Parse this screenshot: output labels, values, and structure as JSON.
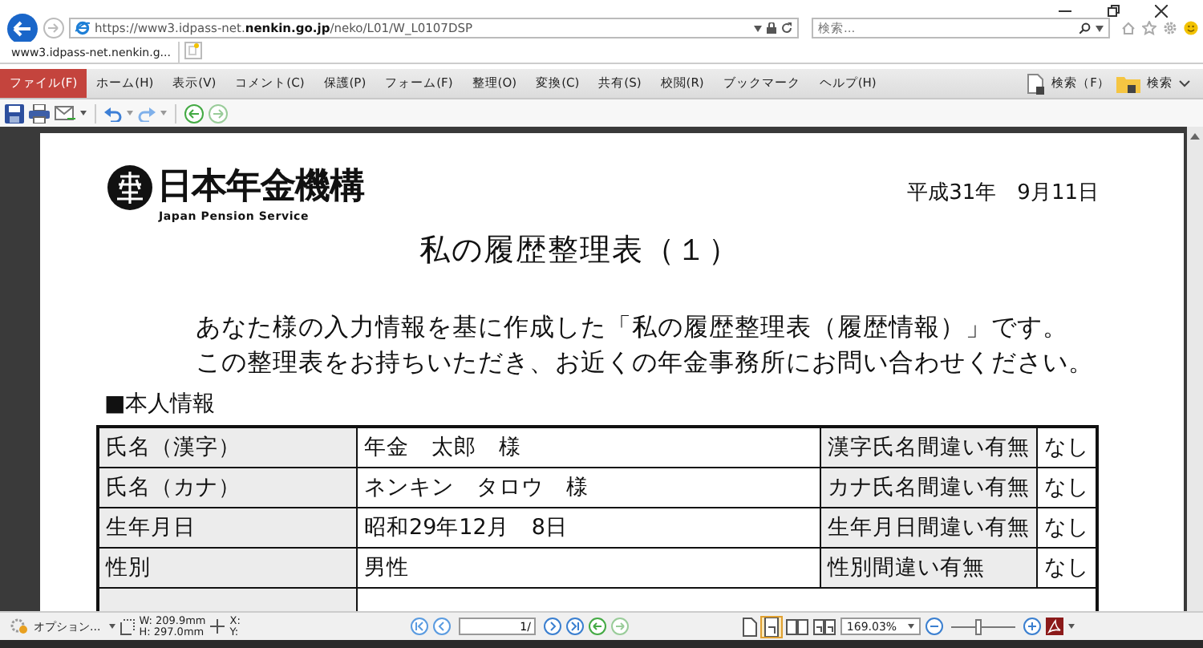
{
  "address_bar": {
    "url": "https://www3.idpass-net.**nenkin.go.jp**/neko/L01/W_L0107DSP"
  },
  "search": {
    "placeholder": "検索..."
  },
  "tabs": [
    {
      "label": "www3.idpass-net.nenkin.g...",
      "selected": true
    }
  ],
  "menu": [
    {
      "label": "ファイル(F)",
      "selected": true
    },
    {
      "label": "ホーム(H)",
      "selected": false
    },
    {
      "label": "表示(V)",
      "selected": false
    },
    {
      "label": "コメント(C)",
      "selected": false
    },
    {
      "label": "保護(P)",
      "selected": false
    },
    {
      "label": "フォーム(F)",
      "selected": false
    },
    {
      "label": "整理(O)",
      "selected": false
    },
    {
      "label": "変換(C)",
      "selected": false
    },
    {
      "label": "共有(S)",
      "selected": false
    },
    {
      "label": "校閲(R)",
      "selected": false
    },
    {
      "label": "ブックマーク",
      "selected": false
    },
    {
      "label": "ヘルプ(H)",
      "selected": false
    }
  ],
  "menu_right": [
    "検索（F）",
    "検索"
  ],
  "document": {
    "org_name": "日本年金機構",
    "org_subtitle": "Japan Pension Service",
    "date": "平成31年　9月11日",
    "title": "私の履歴整理表（１）",
    "intro": [
      "あなた様の入力情報を基に作成した「私の履歴整理表（履歴情報）」です。",
      "この整理表をお持ちいただき、お近くの年金事務所にお問い合わせください。"
    ],
    "section": "■本人情報",
    "table": {
      "rows": [
        [
          "氏名（漢字）",
          "年金　太郎　様",
          "漢字氏名間違い有無",
          "なし"
        ],
        [
          "氏名（カナ）",
          "ネンキン　タロウ　様",
          "カナ氏名間違い有無",
          "なし"
        ],
        [
          "生年月日",
          "昭和29年12月　8日",
          "生年月日間違い有無",
          "なし"
        ],
        [
          "性別",
          "男性",
          "性別間違い有無",
          "なし"
        ]
      ]
    }
  },
  "status_bar": {
    "options": "オプション...",
    "width": "W: 209.9mm",
    "height": "H: 297.0mm",
    "x": "X:",
    "y": "Y:",
    "page": "1/",
    "zoom": "169.03%",
    "level": 0.42
  }
}
